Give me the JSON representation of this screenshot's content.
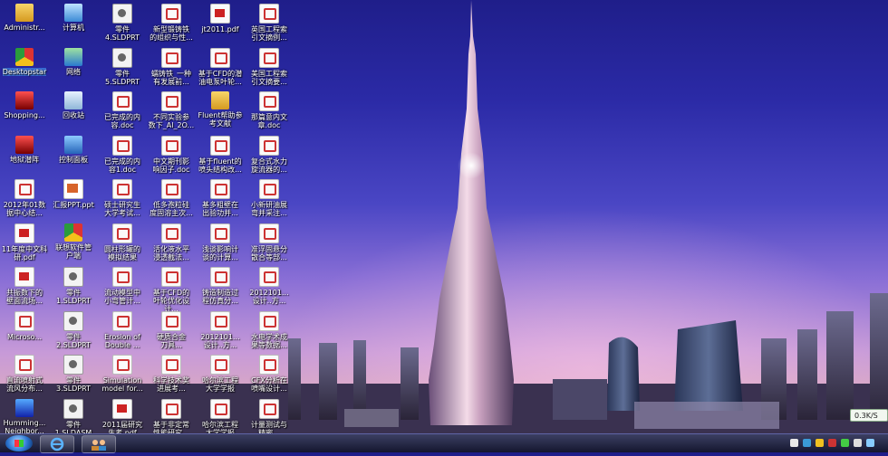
{
  "desktop": {
    "icons": [
      {
        "label": "Administr...",
        "type": "folder"
      },
      {
        "label": "计算机",
        "type": "pc"
      },
      {
        "label": "零件\n4.SLDPRT",
        "type": "sld"
      },
      {
        "label": "新型锻铸铁\n的组织与性...",
        "type": "doc"
      },
      {
        "label": "jt2011.pdf",
        "type": "pdf"
      },
      {
        "label": "英国工程索\n引文摘例...",
        "type": "doc"
      },
      {
        "label": "Desktopstar",
        "type": "chrome",
        "selected": true
      },
      {
        "label": "网络",
        "type": "net"
      },
      {
        "label": "零件\n5.SLDPRT",
        "type": "sld"
      },
      {
        "label": "蠕铸铁_一种\n有发展前...",
        "type": "doc"
      },
      {
        "label": "基于CFD的潜\n油电泵叶轮...",
        "type": "doc"
      },
      {
        "label": "美国工程索\n引文摘要...",
        "type": "doc"
      },
      {
        "label": "Shopping...",
        "type": "app"
      },
      {
        "label": "回收站",
        "type": "bin"
      },
      {
        "label": "已完成的内\n容.doc",
        "type": "doc"
      },
      {
        "label": "不同实验参\n数下_Al_2O...",
        "type": "doc"
      },
      {
        "label": "Fluent帮助参\n考文献",
        "type": "folder"
      },
      {
        "label": "那篇意内文\n章.doc",
        "type": "doc"
      },
      {
        "label": "地狱潜阵",
        "type": "app"
      },
      {
        "label": "控制面板",
        "type": "ctrl"
      },
      {
        "label": "已完成的内\n容1.doc",
        "type": "doc"
      },
      {
        "label": "中文期刊影\n响因子.doc",
        "type": "doc"
      },
      {
        "label": "基于fluent的\n喷头结构改...",
        "type": "doc"
      },
      {
        "label": "复合式水力\n旋流器的...",
        "type": "doc"
      },
      {
        "label": "2012年01数\n据中心结...",
        "type": "doc"
      },
      {
        "label": "汇报PPT.ppt",
        "type": "ppt"
      },
      {
        "label": "硕士研究生\n大学考试...",
        "type": "doc"
      },
      {
        "label": "低多孢粒硅\n度固溶主次...",
        "type": "doc"
      },
      {
        "label": "基多粗壁在\n出验功并...",
        "type": "doc"
      },
      {
        "label": "小新研油展\n弯并采注...",
        "type": "doc"
      },
      {
        "label": "11年度中文科\n研.pdf",
        "type": "pdf"
      },
      {
        "label": "联想软件管\n户端",
        "type": "chrome"
      },
      {
        "label": "圆柱形罐的\n模拟结果",
        "type": "doc"
      },
      {
        "label": "活化液水平\n浸透截法...",
        "type": "doc"
      },
      {
        "label": "浅谈影响计\n谈的计算...",
        "type": "doc"
      },
      {
        "label": "准浮固悬分\n散合等部...",
        "type": "doc"
      },
      {
        "label": "共振数下的\n壁面流场...",
        "type": "pdf"
      },
      {
        "label": "零件\n1.SLDPRT",
        "type": "sld"
      },
      {
        "label": "流动模型中\n小弯管计...",
        "type": "doc"
      },
      {
        "label": "基于CFD的\n叶轮优化设计...",
        "type": "doc"
      },
      {
        "label": "铸造制造过\n程仿真分...",
        "type": "doc"
      },
      {
        "label": "2012101...\n设计..方...",
        "type": "doc"
      },
      {
        "label": "Microso...",
        "type": "doc"
      },
      {
        "label": "零件\n2.SLDPRT",
        "type": "sld"
      },
      {
        "label": "Erosion of\nDouble ...",
        "type": "doc"
      },
      {
        "label": "硬质合金\n刀具...",
        "type": "doc"
      },
      {
        "label": "2012101...\n设计..方...",
        "type": "doc"
      },
      {
        "label": "水电学术成\n果等数据...",
        "type": "doc"
      },
      {
        "label": "直流喷射式\n流风分布...",
        "type": "doc"
      },
      {
        "label": "零件\n3.SLDPRT",
        "type": "sld"
      },
      {
        "label": "Simulation\nmodel for...",
        "type": "doc"
      },
      {
        "label": "科学技术奖\n进展考...",
        "type": "doc"
      },
      {
        "label": "哈尔滨工程\n大学学报",
        "type": "doc"
      },
      {
        "label": "CFX分析在\n喷嘴设计...",
        "type": "doc"
      },
      {
        "label": "Humming...\nNeighbor...",
        "type": "ansys"
      },
      {
        "label": "零件\n1.SLDASM",
        "type": "sld"
      },
      {
        "label": "2011届研究\n生考.pdf",
        "type": "pdf"
      },
      {
        "label": "基于非定常\n性能研究...",
        "type": "doc"
      },
      {
        "label": "哈尔滨工程\n大学学报",
        "type": "doc"
      },
      {
        "label": "计量测试与\n精密...",
        "type": "doc"
      }
    ]
  },
  "notification": {
    "text": "0.3K/S"
  },
  "taskbar": {
    "start_label": "Start"
  }
}
